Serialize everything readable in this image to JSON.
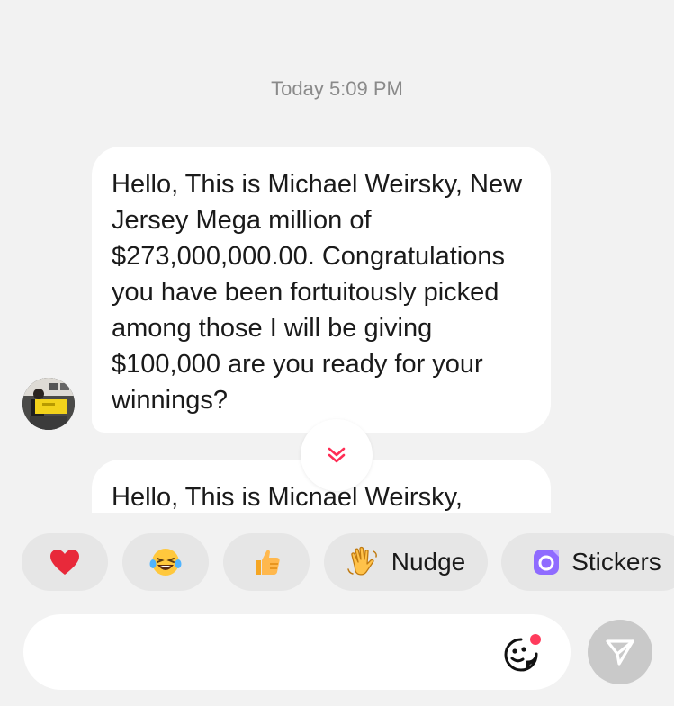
{
  "chat": {
    "timestamp": "Today 5:09 PM",
    "messages": [
      {
        "text": "Hello, This is Michael Weirsky, New Jersey Mega million of $273,000,000.00. Congratulations you have been fortuitously picked among those I will be giving $100,000 are you ready for your winnings?"
      },
      {
        "text": "Hello, This is Micnael Weirsky,"
      }
    ]
  },
  "quick_reactions": [
    {
      "icon": "heart-icon",
      "label": ""
    },
    {
      "icon": "laughing-face-icon",
      "label": ""
    },
    {
      "icon": "thumbs-up-icon",
      "label": ""
    },
    {
      "icon": "waving-hand-icon",
      "label": "Nudge"
    },
    {
      "icon": "stickers-icon",
      "label": "Stickers"
    }
  ],
  "composer": {
    "placeholder": "",
    "emoji_icon": "sticker-face-icon",
    "send_icon": "send-icon"
  },
  "colors": {
    "background": "#f2f2f2",
    "bubble": "#ffffff",
    "chip": "#e6e6e6",
    "send_button": "#c9c9c9",
    "notification_dot": "#ff3b5c",
    "stickers_accent": "#7b5cff"
  }
}
